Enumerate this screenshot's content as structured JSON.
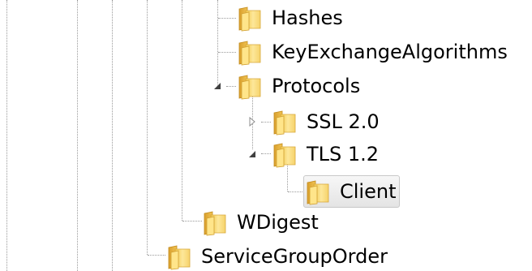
{
  "tree": {
    "nodes": [
      {
        "id": "hashes",
        "label": "Hashes",
        "state": "leaf"
      },
      {
        "id": "keyexchange",
        "label": "KeyExchangeAlgorithms",
        "state": "leaf"
      },
      {
        "id": "protocols",
        "label": "Protocols",
        "state": "expanded"
      },
      {
        "id": "ssl20",
        "label": "SSL 2.0",
        "state": "collapsed"
      },
      {
        "id": "tls12",
        "label": "TLS 1.2",
        "state": "expanded"
      },
      {
        "id": "client",
        "label": "Client",
        "state": "selected"
      },
      {
        "id": "wdigest",
        "label": "WDigest",
        "state": "leaf"
      },
      {
        "id": "servicegrouporder",
        "label": "ServiceGroupOrder",
        "state": "leaf"
      }
    ]
  },
  "colors": {
    "folder_light": "#fde79a",
    "folder_dark": "#e8b33c",
    "line": "#9a9a9a",
    "selection_border": "#c8c8c8"
  },
  "icons": {
    "folder": "folder-icon",
    "expanded": "expanded-triangle-icon",
    "collapsed": "collapsed-triangle-icon"
  }
}
